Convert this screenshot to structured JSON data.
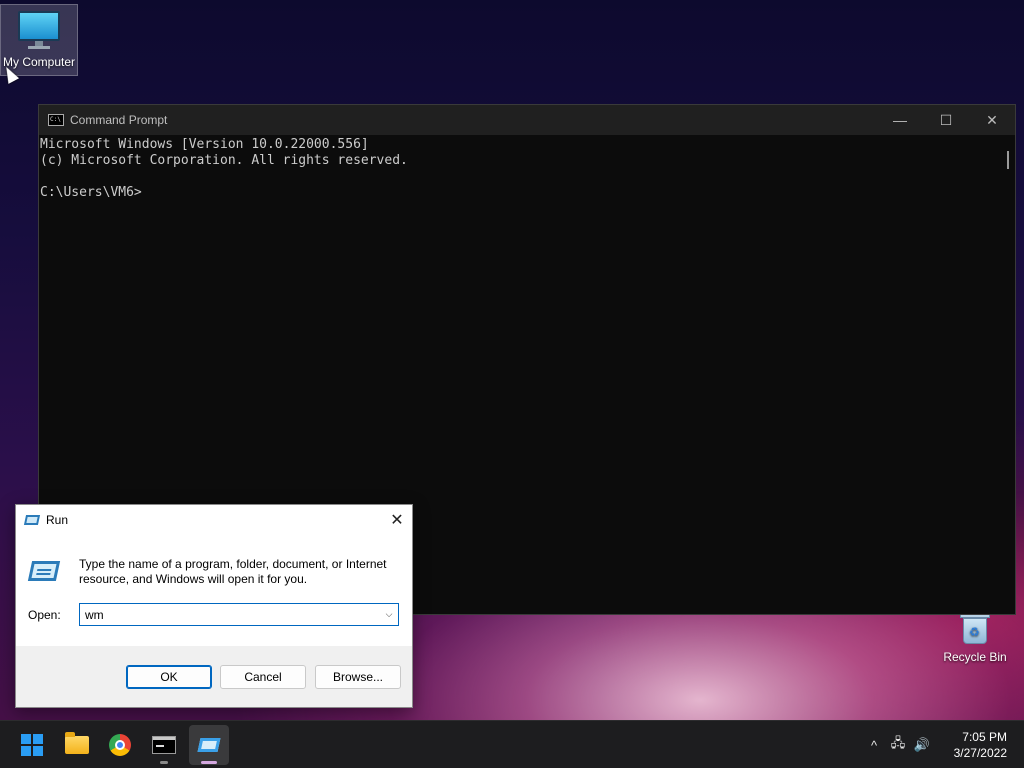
{
  "desktop": {
    "icons": [
      {
        "label": "My Computer"
      },
      {
        "label": "Recycle Bin"
      }
    ]
  },
  "cmd_window": {
    "title": "Command Prompt",
    "lines": [
      "Microsoft Windows [Version 10.0.22000.556]",
      "(c) Microsoft Corporation. All rights reserved.",
      "",
      "C:\\Users\\VM6>"
    ],
    "controls": {
      "minimize": "—",
      "maximize": "☐",
      "close": "✕"
    }
  },
  "run_dialog": {
    "title": "Run",
    "close": "✕",
    "description": "Type the name of a program, folder, document, or Internet resource, and Windows will open it for you.",
    "open_label": "Open:",
    "open_value": "wm",
    "dropdown": "⌵",
    "buttons": {
      "ok": "OK",
      "cancel": "Cancel",
      "browse": "Browse..."
    }
  },
  "taskbar": {
    "items": [
      "start-icon",
      "file-explorer-icon",
      "chrome-icon",
      "command-prompt-icon",
      "run-icon"
    ],
    "active_item": "run-icon",
    "tray": {
      "chevron": "^",
      "network": "🖧",
      "volume": "🔊"
    },
    "clock": {
      "time": "7:05 PM",
      "date": "3/27/2022"
    }
  },
  "colors": {
    "accent": "#0067c0",
    "taskbar": "#1d1d1f",
    "cmd_background": "#0c0c0c",
    "cmd_text": "#cccccc"
  }
}
